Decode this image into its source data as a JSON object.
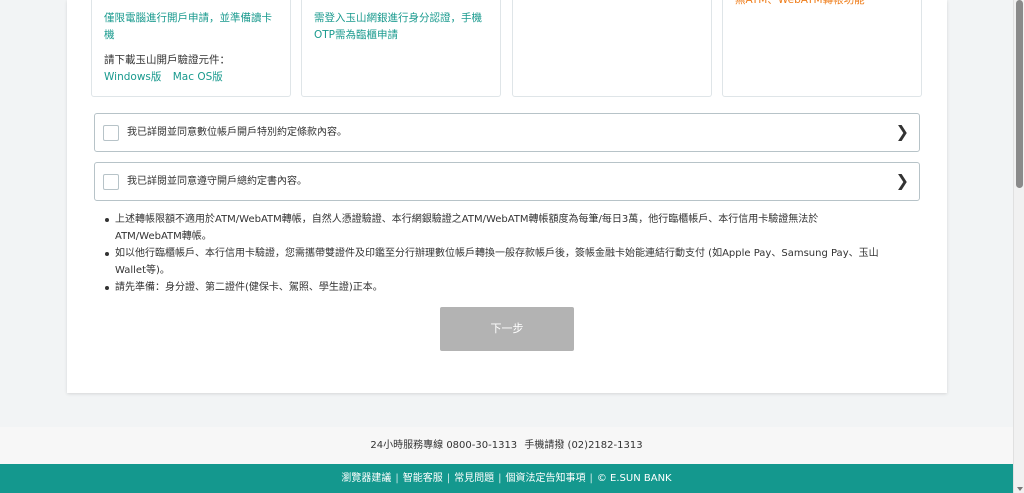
{
  "info_boxes": {
    "box1": {
      "line1": "僅限電腦進行開戶申請，並準備讀卡",
      "line2": "機",
      "download_label": "請下載玉山開戶驗證元件：",
      "link_windows": "Windows版",
      "link_mac": "Mac OS版"
    },
    "box2": {
      "line1": "需登入玉山網銀進行身分認證，手機",
      "line2": "OTP需為臨櫃申請"
    },
    "box4": {
      "line1": "無ATM、WebATM轉帳功能"
    }
  },
  "agreements": [
    {
      "label": "我已詳閱並同意數位帳戶開戶特別約定條款內容。"
    },
    {
      "label": "我已詳閱並同意遵守開戶總約定書內容。"
    }
  ],
  "notes": [
    {
      "line1": "上述轉帳限額不適用於ATM/WebATM轉帳，自然人憑證驗證、本行網銀驗證之ATM/WebATM轉帳額度為每筆/每日3萬，他行臨櫃帳戶、本行信用卡驗證無法於",
      "line2": "ATM/WebATM轉帳。"
    },
    {
      "line1": "如以他行臨櫃帳戶、本行信用卡驗證，您需攜帶雙證件及印鑑至分行辦理數位帳戶轉換一般存款帳戶後，簽帳金融卡始能連結行動支付 (如Apple Pay、Samsung Pay、玉山",
      "line2": "Wallet等)。"
    },
    {
      "line1": "請先準備：身分證、第二證件(健保卡、駕照、學生證)正本。",
      "line2": ""
    }
  ],
  "next_button": "下一步",
  "service": {
    "hotline": "24小時服務專線 0800-30-1313",
    "mobile": "手機請撥 (02)2182-1313"
  },
  "footer": {
    "links": [
      "瀏覽器建議",
      "智能客服",
      "常見問題",
      "個資法定告知事項"
    ],
    "copyright": "© E.SUN BANK",
    "separator": "|"
  },
  "colors": {
    "accent": "#199a8e",
    "footer_bg": "#14988e",
    "orange_text": "#ef7d1a",
    "disabled_button": "#b3b3b3"
  }
}
